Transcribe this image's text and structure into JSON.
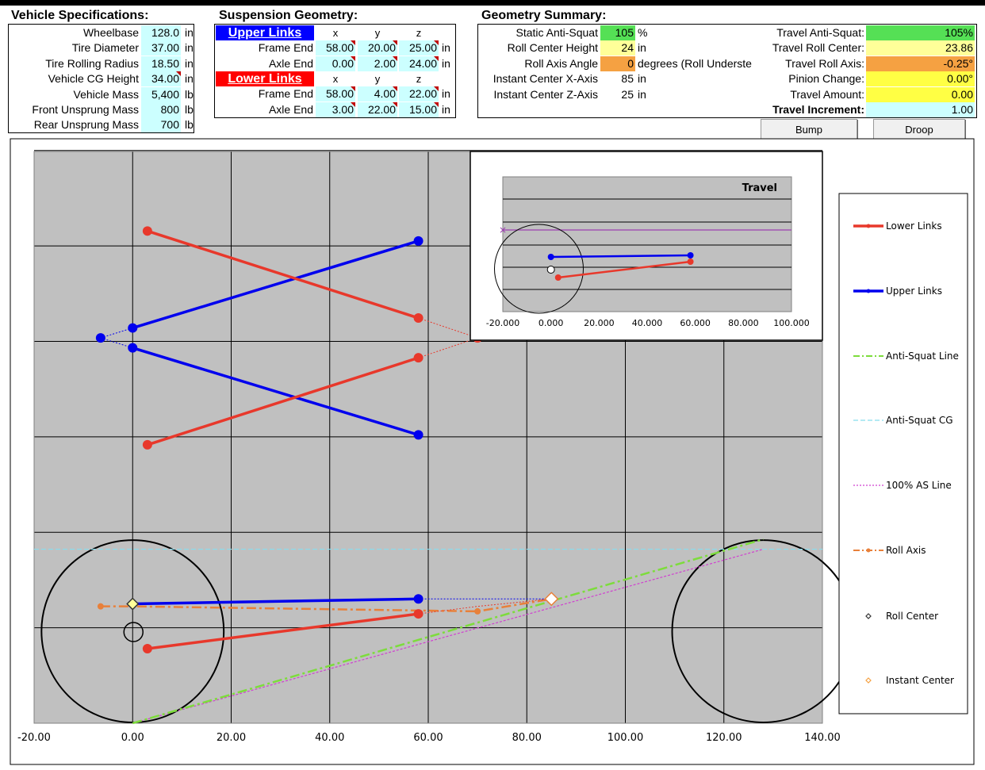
{
  "vehicle": {
    "title": "Vehicle Specifications:",
    "rows": [
      {
        "label": "Wheelbase",
        "value": "128.0",
        "unit": "in"
      },
      {
        "label": "Tire Diameter",
        "value": "37.00",
        "unit": "in"
      },
      {
        "label": "Tire Rolling Radius",
        "value": "18.50",
        "unit": "in"
      },
      {
        "label": "Vehicle CG Height",
        "value": "34.00",
        "unit": "in"
      },
      {
        "label": "Vehicle Mass",
        "value": "5,400",
        "unit": "lb"
      },
      {
        "label": "Front Unsprung Mass",
        "value": "800",
        "unit": "lb"
      },
      {
        "label": "Rear Unsprung Mass",
        "value": "700",
        "unit": "lb"
      }
    ]
  },
  "suspension": {
    "title": "Suspension Geometry:",
    "upper_header": "Upper Links",
    "lower_header": "Lower Links",
    "col_x": "x",
    "col_y": "y",
    "col_z": "z",
    "unit": "in",
    "upper": [
      {
        "label": "Frame End",
        "x": "58.00",
        "y": "20.00",
        "z": "25.00"
      },
      {
        "label": "Axle End",
        "x": "0.00",
        "y": "2.00",
        "z": "24.00"
      }
    ],
    "lower": [
      {
        "label": "Frame End",
        "x": "58.00",
        "y": "4.00",
        "z": "22.00"
      },
      {
        "label": "Axle End",
        "x": "3.00",
        "y": "22.00",
        "z": "15.00"
      }
    ]
  },
  "summary": {
    "title": "Geometry Summary:",
    "left": [
      {
        "label": "Static Anti-Squat",
        "value": "105",
        "unit": "%",
        "color": "#55e055"
      },
      {
        "label": "Roll Center Height",
        "value": "24",
        "unit": "in",
        "color": "#ffff99"
      },
      {
        "label": "Roll Axis Angle",
        "value": "0",
        "unit": "degrees (Roll Underste",
        "color": "#f5a142"
      },
      {
        "label": "Instant Center X-Axis",
        "value": "85",
        "unit": "in",
        "color": "#ffffff"
      },
      {
        "label": "Instant Center Z-Axis",
        "value": "25",
        "unit": "in",
        "color": "#ffffff"
      }
    ],
    "right": [
      {
        "label": "Travel Anti-Squat:",
        "value": "105%",
        "color": "#55e055"
      },
      {
        "label": "Travel Roll Center:",
        "value": "23.86",
        "color": "#ffff99"
      },
      {
        "label": "Travel Roll Axis:",
        "value": "-0.25°",
        "color": "#f5a142"
      },
      {
        "label": "Pinion Change:",
        "value": "0.00°",
        "color": "#ffff44"
      },
      {
        "label": "Travel Amount:",
        "value": "0.00",
        "color": "#ffff44"
      },
      {
        "label": "Travel Increment:",
        "value": "1.00",
        "color": "#ccffff"
      }
    ]
  },
  "buttons": {
    "bump": "Bump",
    "droop": "Droop"
  },
  "legend": [
    {
      "label": "Lower Links",
      "color": "#e8382b"
    },
    {
      "label": "Upper Links",
      "color": "#0000ee"
    },
    {
      "label": "Anti-Squat Line",
      "color": "#7ddc3c"
    },
    {
      "label": "Anti-Squat CG",
      "color": "#88ddee"
    },
    {
      "label": "100% AS Line",
      "color": "#d040d0"
    },
    {
      "label": "Roll Axis",
      "color": "#e8803a"
    },
    {
      "label": "Roll Center",
      "color": "#333333"
    },
    {
      "label": "Instant Center",
      "color": "#f5a142"
    }
  ],
  "inset_chart": {
    "title": "Travel",
    "x_ticks": [
      "-20.000",
      "0.000",
      "20.000",
      "40.000",
      "60.000",
      "80.000",
      "100.000"
    ]
  },
  "chart_data": {
    "type": "scatter",
    "x_ticks": [
      "-20.00",
      "0.00",
      "20.00",
      "40.00",
      "60.00",
      "80.00",
      "100.00",
      "120.00",
      "140.00"
    ],
    "xlim": [
      -20,
      140
    ],
    "ylim": [
      0,
      115
    ],
    "grid": true,
    "legend_position": "right",
    "side_view": {
      "upper_link": [
        [
          0,
          24
        ],
        [
          58,
          25
        ]
      ],
      "lower_link": [
        [
          3,
          15
        ],
        [
          58,
          22
        ]
      ],
      "upper_ext": [
        [
          58,
          25
        ],
        [
          85,
          25
        ]
      ],
      "lower_ext": [
        [
          58,
          22
        ],
        [
          70,
          23.5
        ],
        [
          85,
          25
        ]
      ],
      "roll_axis": [
        [
          -6.5,
          23.5
        ],
        [
          0,
          23.5
        ],
        [
          70,
          22.5
        ],
        [
          85,
          25
        ]
      ],
      "anti_squat_line": [
        [
          0,
          0
        ],
        [
          128,
          37
        ]
      ],
      "as100_line": [
        [
          0,
          0
        ],
        [
          128,
          35
        ]
      ],
      "anti_squat_cg_y": 35,
      "instant_center": [
        85,
        25
      ],
      "roll_center": [
        0,
        24
      ],
      "wheels": [
        {
          "cx": 0,
          "cy": 18.5,
          "r": 18.5
        },
        {
          "cx": 128,
          "cy": 18.5,
          "r": 18.5
        }
      ],
      "hub_circle": {
        "cx": 0,
        "cy": 18.5,
        "r": 2
      }
    },
    "top_view": {
      "upper_link_a": [
        [
          0,
          79.5
        ],
        [
          58,
          97
        ]
      ],
      "upper_link_b": [
        [
          0,
          75.5
        ],
        [
          58,
          58
        ]
      ],
      "lower_link_a": [
        [
          3,
          99
        ],
        [
          58,
          81.5
        ]
      ],
      "lower_link_b": [
        [
          3,
          56
        ],
        [
          58,
          73.5
        ]
      ],
      "upper_apex": [
        -6.5,
        77.5
      ],
      "lower_apex": [
        70,
        77.5
      ]
    }
  }
}
